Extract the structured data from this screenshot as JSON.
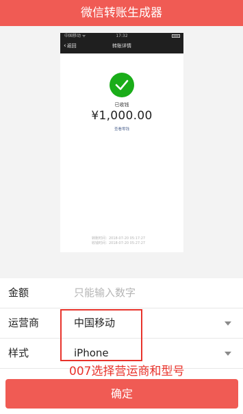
{
  "header": {
    "title": "微信转账生成器"
  },
  "preview": {
    "status_bar": {
      "carrier": "中国移动 ᯤ",
      "time": "17:32"
    },
    "nav": {
      "back_label": "返回",
      "title": "转账详情"
    },
    "status_text": "已收钱",
    "amount": "¥1,000.00",
    "change_link": "查看零钱",
    "transfer_time": "转账时间：2018-07-20  05:17:27",
    "receive_time": "收钱时间：2018-07-20  05:27:27"
  },
  "form": {
    "amount": {
      "label": "金额",
      "placeholder": "只能输入数字"
    },
    "carrier": {
      "label": "运营商",
      "value": "中国移动"
    },
    "style": {
      "label": "样式",
      "value": "iPhone"
    }
  },
  "annotation": "007选择营运商和型号",
  "confirm_label": "确定",
  "colors": {
    "brand": "#f05b54",
    "success": "#1aad19",
    "annotation": "#e8322a",
    "link": "#576b95"
  }
}
